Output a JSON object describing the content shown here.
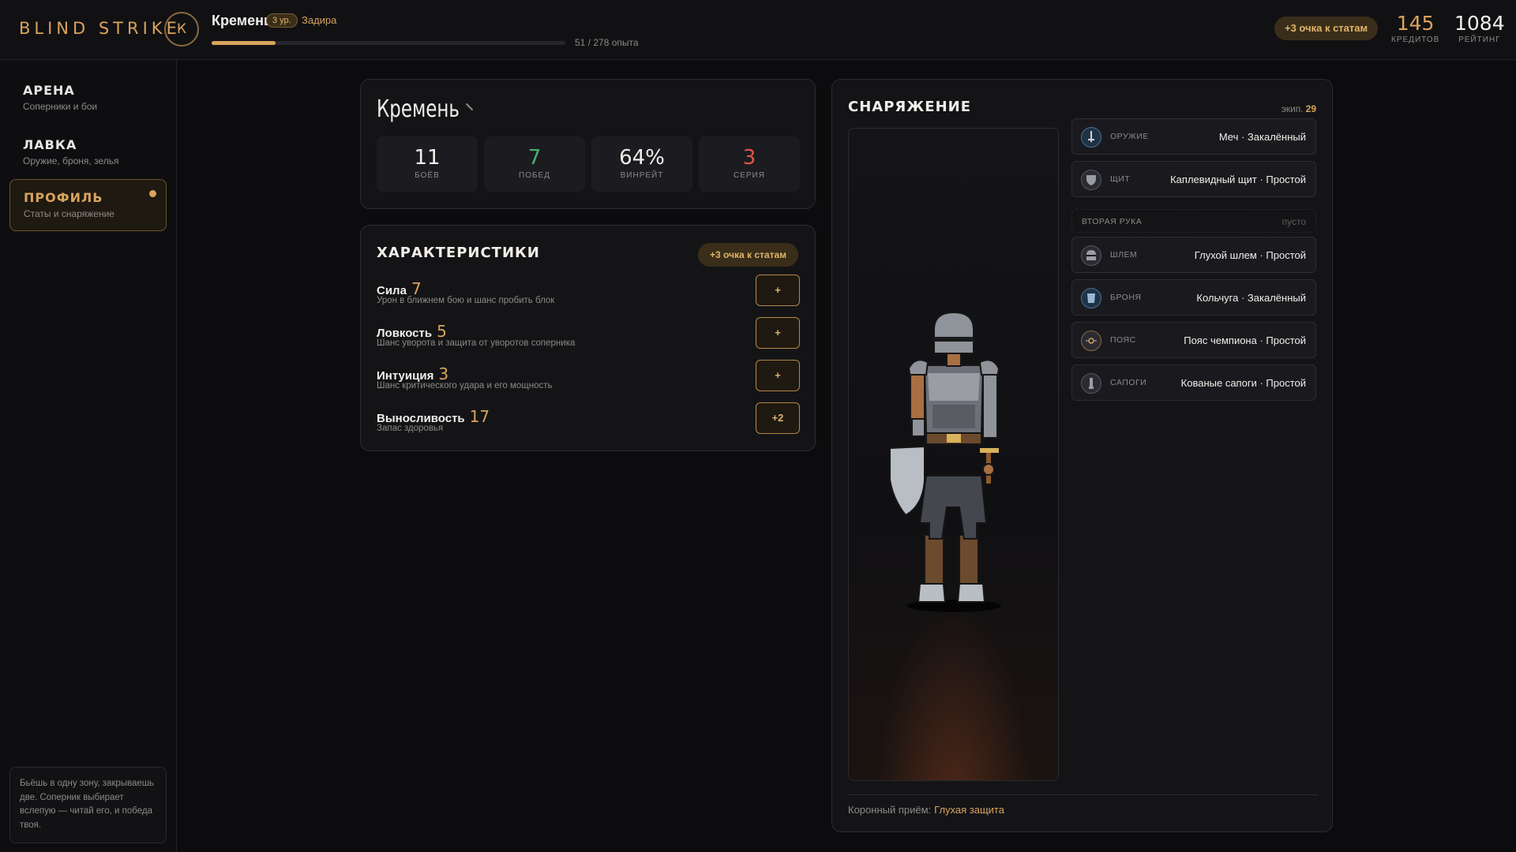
{
  "header": {
    "logo": "BLIND STRIKE",
    "avatar_letter": "К",
    "player_name": "Кремень",
    "level": "3 ур.",
    "player_class": "Задира",
    "xp_text": "51 / 278 опыта",
    "xp_progress": 0.18,
    "stat_points": "+3 очка к статам",
    "credits": {
      "value": "145",
      "label": "КРЕДИТОВ"
    },
    "rating": {
      "value": "1084",
      "label": "РЕЙТИНГ"
    }
  },
  "sidebar": {
    "items": [
      {
        "title": "АРЕНА",
        "subtitle": "Соперники и бои"
      },
      {
        "title": "ЛАВКА",
        "subtitle": "Оружие, броня, зелья"
      },
      {
        "title": "ПРОФИЛЬ",
        "subtitle": "Статы и снаряжение",
        "active": true
      }
    ],
    "hint": "Бьёшь в одну зону, закрываешь две. Соперник выбирает вслепую — читай его, и победа твоя."
  },
  "profile": {
    "name": "Кремень",
    "stats": [
      {
        "value": "11",
        "label": "БОЁВ",
        "color": "#f1eee9"
      },
      {
        "value": "7",
        "label": "ПОБЕД",
        "color": "#4caf6e"
      },
      {
        "value": "64%",
        "label": "ВИНРЕЙТ",
        "color": "#f1eee9"
      },
      {
        "value": "3",
        "label": "СЕРИЯ",
        "color": "#e0554a"
      }
    ]
  },
  "attributes": {
    "title": "ХАРАКТЕРИСТИКИ",
    "points_label": "+3 очка к статам",
    "rows": [
      {
        "name": "Сила",
        "value": "7",
        "desc": "Урон в ближнем бою и шанс пробить блок",
        "button": "+"
      },
      {
        "name": "Ловкость",
        "value": "5",
        "desc": "Шанс уворота и защита от уворотов соперника",
        "button": "+"
      },
      {
        "name": "Интуиция",
        "value": "3",
        "desc": "Шанс критического удара и его мощность",
        "button": "+"
      },
      {
        "name": "Выносливость",
        "value": "17",
        "desc": "Запас здоровья",
        "button": "+2"
      }
    ]
  },
  "gear": {
    "title": "СНАРЯЖЕНИЕ",
    "count_label": "экип.",
    "count_value": "29",
    "slots": [
      {
        "kind": "ОРУЖИЕ",
        "item": "Меч · Закалённый",
        "icon": "sword-icon"
      },
      {
        "kind": "ЩИТ",
        "item": "Каплевидный щит · Простой",
        "icon": "shield-icon"
      },
      {
        "kind": "ВТОРАЯ РУКА",
        "item": "пусто",
        "empty": true
      },
      {
        "kind": "ШЛЕМ",
        "item": "Глухой шлем · Простой",
        "icon": "helmet-icon"
      },
      {
        "kind": "БРОНЯ",
        "item": "Кольчуга · Закалённый",
        "icon": "armor-icon"
      },
      {
        "kind": "ПОЯС",
        "item": "Пояс чемпиона · Простой",
        "icon": "belt-icon"
      },
      {
        "kind": "САПОГИ",
        "item": "Кованые сапоги · Простой",
        "icon": "boots-icon"
      }
    ],
    "signature_label": "Коронный приём:",
    "signature_value": "Глухая защита"
  }
}
